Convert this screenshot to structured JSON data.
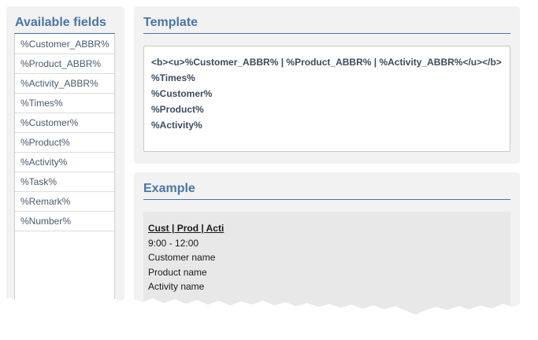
{
  "available_fields": {
    "title": "Available fields",
    "items": [
      "%Customer_ABBR%",
      "%Product_ABBR%",
      "%Activity_ABBR%",
      "%Times%",
      "%Customer%",
      "%Product%",
      "%Activity%",
      "%Task%",
      "%Remark%",
      "%Number%"
    ]
  },
  "template": {
    "title": "Template",
    "lines": [
      "<b><u>%Customer_ABBR% | %Product_ABBR% | %Activity_ABBR%</u></b>",
      "%Times%",
      "%Customer%",
      "%Product%",
      "%Activity%"
    ]
  },
  "example": {
    "title": "Example",
    "heading": "Cust | Prod | Acti",
    "lines": [
      "9:00 - 12:00",
      "Customer name",
      "Product name",
      "Activity name"
    ]
  },
  "colors": {
    "accent": "#4a76a8",
    "panel_bg": "#f2f2f2",
    "example_bg": "#e8e8e8"
  }
}
